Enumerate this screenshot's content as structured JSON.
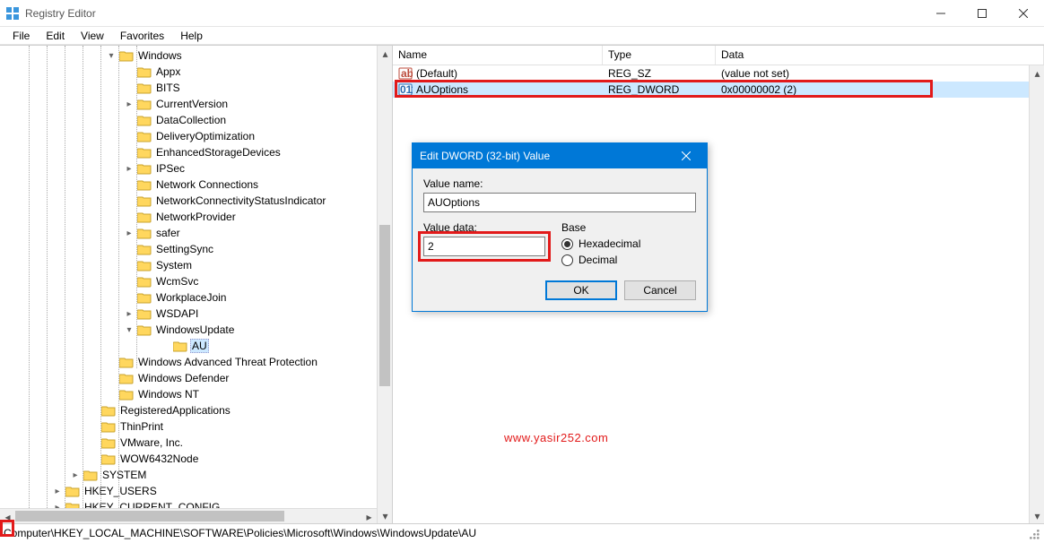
{
  "window": {
    "title": "Registry Editor"
  },
  "menu": {
    "file": "File",
    "edit": "Edit",
    "view": "View",
    "favorites": "Favorites",
    "help": "Help"
  },
  "tree": {
    "windows": "Windows",
    "items": [
      "Appx",
      "BITS",
      "CurrentVersion",
      "DataCollection",
      "DeliveryOptimization",
      "EnhancedStorageDevices",
      "IPSec",
      "Network Connections",
      "NetworkConnectivityStatusIndicator",
      "NetworkProvider",
      "safer",
      "SettingSync",
      "System",
      "WcmSvc",
      "WorkplaceJoin",
      "WSDAPI",
      "WindowsUpdate"
    ],
    "au": "AU",
    "after": [
      "Windows Advanced Threat Protection",
      "Windows Defender",
      "Windows NT"
    ],
    "level2": [
      "RegisteredApplications",
      "ThinPrint",
      "VMware, Inc.",
      "WOW6432Node"
    ],
    "level1": [
      "SYSTEM"
    ],
    "roots": [
      "HKEY_USERS",
      "HKEY_CURRENT_CONFIG"
    ]
  },
  "list": {
    "headers": {
      "name": "Name",
      "type": "Type",
      "data": "Data"
    },
    "rows": [
      {
        "name": "(Default)",
        "type": "REG_SZ",
        "data": "(value not set)",
        "icon": "string"
      },
      {
        "name": "AUOptions",
        "type": "REG_DWORD",
        "data": "0x00000002 (2)",
        "icon": "binary"
      }
    ]
  },
  "dialog": {
    "title": "Edit DWORD (32-bit) Value",
    "valuename_label": "Value name:",
    "valuename": "AUOptions",
    "valuedata_label": "Value data:",
    "valuedata": "2",
    "base_label": "Base",
    "hex": "Hexadecimal",
    "dec": "Decimal",
    "ok": "OK",
    "cancel": "Cancel"
  },
  "status": {
    "path": "Computer\\HKEY_LOCAL_MACHINE\\SOFTWARE\\Policies\\Microsoft\\Windows\\WindowsUpdate\\AU"
  },
  "watermark": "www.yasir252.com"
}
